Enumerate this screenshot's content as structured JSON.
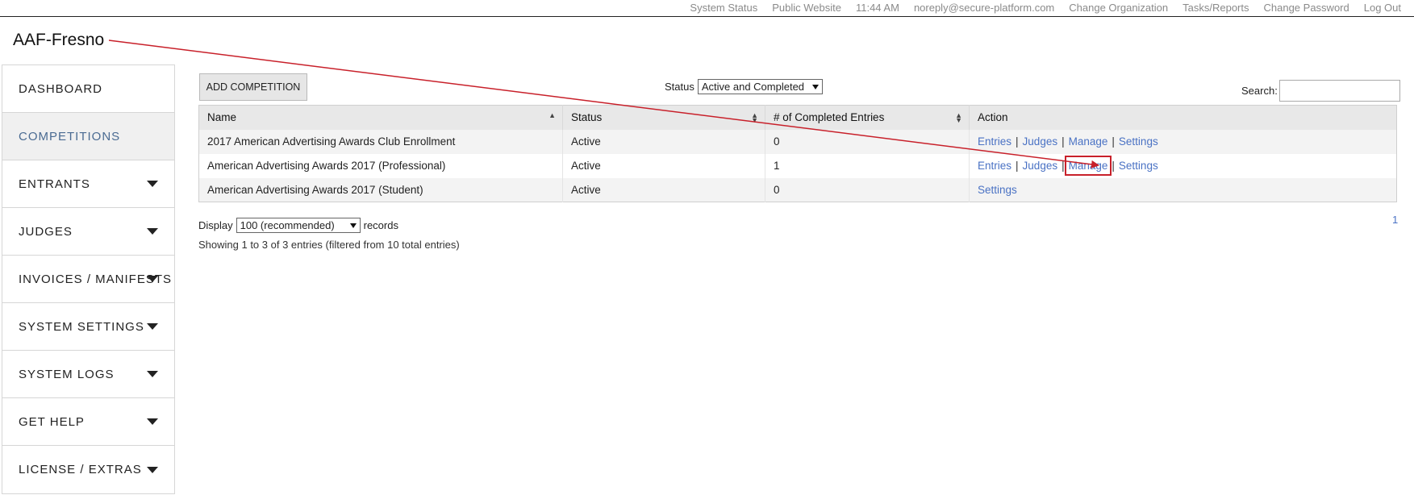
{
  "header": {
    "links": [
      {
        "label": "System Status",
        "name": "system-status-link",
        "interactable": true
      },
      {
        "label": "Public Website",
        "name": "public-website-link",
        "interactable": true
      },
      {
        "label": "11:44 AM",
        "name": "clock-text",
        "interactable": false
      },
      {
        "label": "noreply@secure-platform.com",
        "name": "user-email-text",
        "interactable": false
      },
      {
        "label": "Change Organization",
        "name": "change-organization-link",
        "interactable": true
      },
      {
        "label": "Tasks/Reports",
        "name": "tasks-reports-link",
        "interactable": true
      },
      {
        "label": "Change Password",
        "name": "change-password-link",
        "interactable": true
      },
      {
        "label": "Log Out",
        "name": "log-out-link",
        "interactable": true
      }
    ],
    "org_title": "AAF-Fresno"
  },
  "sidebar": {
    "items": [
      {
        "label": "DASHBOARD",
        "has_dropdown": false,
        "active": false
      },
      {
        "label": "COMPETITIONS",
        "has_dropdown": false,
        "active": true
      },
      {
        "label": "ENTRANTS",
        "has_dropdown": true,
        "active": false
      },
      {
        "label": "JUDGES",
        "has_dropdown": true,
        "active": false
      },
      {
        "label": "INVOICES / MANIFESTS",
        "has_dropdown": true,
        "active": false
      },
      {
        "label": "SYSTEM SETTINGS",
        "has_dropdown": true,
        "active": false
      },
      {
        "label": "SYSTEM LOGS",
        "has_dropdown": true,
        "active": false
      },
      {
        "label": "GET HELP",
        "has_dropdown": true,
        "active": false
      },
      {
        "label": "LICENSE / EXTRAS",
        "has_dropdown": true,
        "active": false
      }
    ]
  },
  "toolbar": {
    "add_label": "ADD COMPETITION",
    "status_label": "Status",
    "status_value": "Active and Completed",
    "search_label": "Search:",
    "search_value": ""
  },
  "table": {
    "columns": [
      "Name",
      "Status",
      "# of Completed Entries",
      "Action"
    ],
    "rows": [
      {
        "name": "2017 American Advertising Awards Club Enrollment",
        "status": "Active",
        "entries": "0",
        "actions": [
          "Entries",
          "Judges",
          "Manage",
          "Settings"
        ]
      },
      {
        "name": "American Advertising Awards 2017 (Professional)",
        "status": "Active",
        "entries": "1",
        "actions": [
          "Entries",
          "Judges",
          "Manage",
          "Settings"
        ]
      },
      {
        "name": "American Advertising Awards 2017 (Student)",
        "status": "Active",
        "entries": "0",
        "actions": [
          "Settings"
        ]
      }
    ]
  },
  "footer": {
    "display_label": "Display",
    "display_value": "100 (recommended)",
    "records_label": "records",
    "showing_text": "Showing 1 to 3 of 3 entries (filtered from 10 total entries)",
    "page": "1"
  },
  "colors": {
    "link": "#4a72c4",
    "annotation": "#c8202a",
    "active_nav": "#4a6b92"
  }
}
